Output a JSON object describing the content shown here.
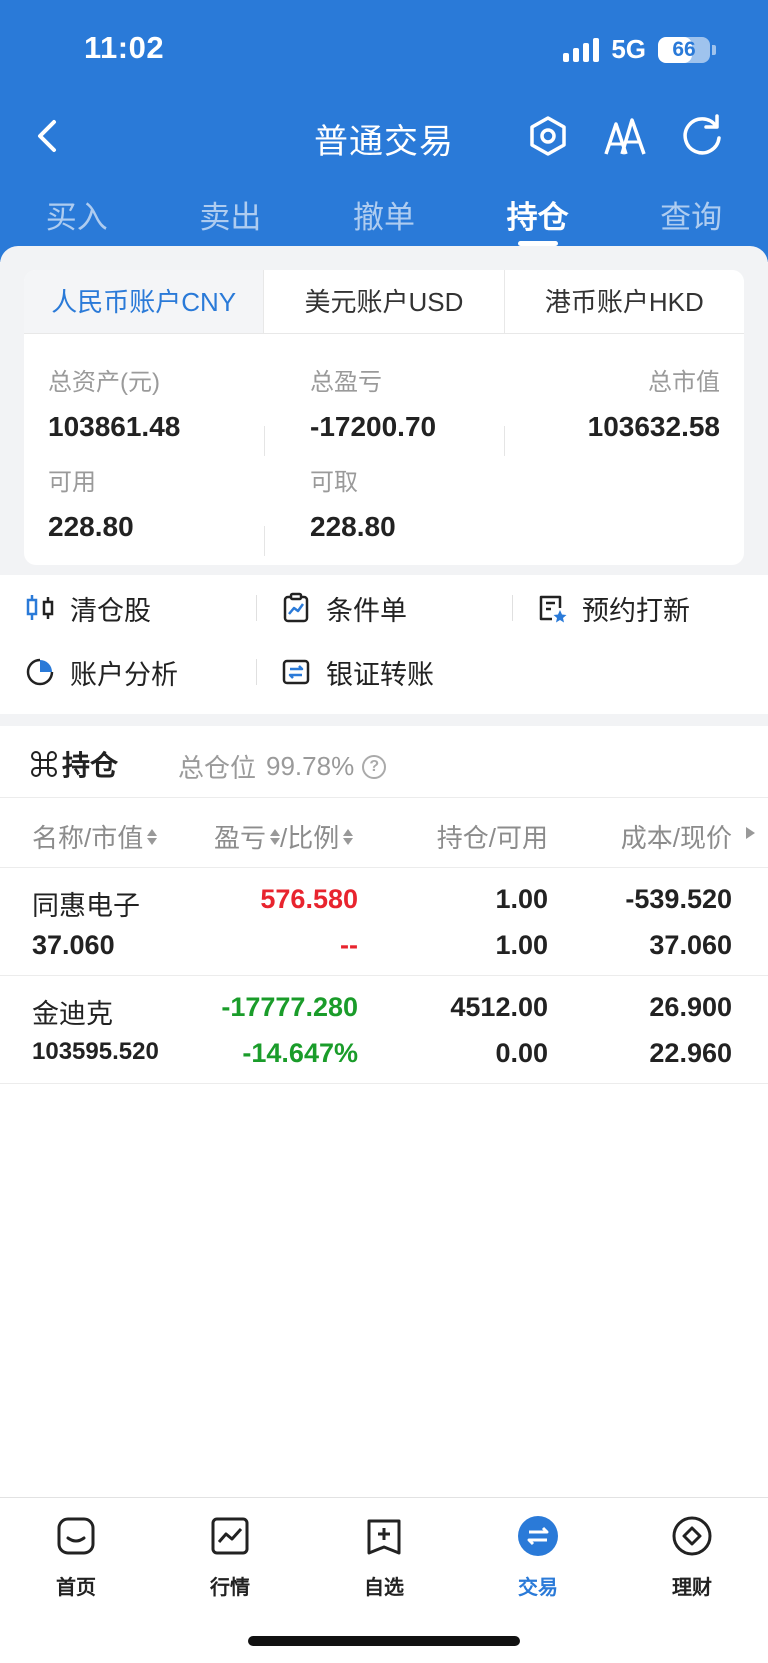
{
  "status": {
    "time": "11:02",
    "network": "5G",
    "battery": "66",
    "battery_level": 0.66
  },
  "nav": {
    "title": "普通交易"
  },
  "tabs": [
    {
      "label": "买入"
    },
    {
      "label": "卖出"
    },
    {
      "label": "撤单"
    },
    {
      "label": "持仓",
      "active": true
    },
    {
      "label": "查询"
    }
  ],
  "account": {
    "tabs": [
      {
        "label": "人民币账户CNY",
        "active": true
      },
      {
        "label": "美元账户USD"
      },
      {
        "label": "港币账户HKD"
      }
    ],
    "total_assets_label": "总资产(元)",
    "total_assets": "103861.48",
    "total_pl_label": "总盈亏",
    "total_pl": "-17200.70",
    "market_value_label": "总市值",
    "market_value": "103632.58",
    "available_label": "可用",
    "available": "228.80",
    "withdrawable_label": "可取",
    "withdrawable": "228.80"
  },
  "actions": [
    {
      "label": "清仓股",
      "icon": "clear-position-icon"
    },
    {
      "label": "条件单",
      "icon": "condition-order-icon"
    },
    {
      "label": "预约打新",
      "icon": "ipo-reserve-icon"
    },
    {
      "label": "账户分析",
      "icon": "pie-chart-icon"
    },
    {
      "label": "银证转账",
      "icon": "transfer-icon"
    }
  ],
  "holdings": {
    "title": "持仓",
    "position_label": "总仓位",
    "position_value": "99.78%",
    "columns": {
      "name": "名称/市值",
      "pl": "盈亏",
      "ratio": "/比例",
      "hold": "持仓/可用",
      "cost": "成本/现价"
    },
    "rows": [
      {
        "name": "同惠电子",
        "market_value": "37.060",
        "pl": "576.580",
        "ratio": "--",
        "hold": "1.00",
        "available": "1.00",
        "cost": "-539.520",
        "price": "37.060"
      },
      {
        "name": "金迪克",
        "market_value": "103595.520",
        "pl": "-17777.280",
        "ratio": "-14.647%",
        "hold": "4512.00",
        "available": "0.00",
        "cost": "26.900",
        "price": "22.960"
      }
    ]
  },
  "bottom_nav": [
    {
      "label": "首页",
      "icon": "home-icon"
    },
    {
      "label": "行情",
      "icon": "market-icon"
    },
    {
      "label": "自选",
      "icon": "watchlist-icon"
    },
    {
      "label": "交易",
      "icon": "trade-icon",
      "active": true
    },
    {
      "label": "理财",
      "icon": "wealth-icon"
    }
  ],
  "colors": {
    "brand": "#2a7ad8",
    "gain": "#e8242e",
    "loss": "#1a9c2a"
  }
}
